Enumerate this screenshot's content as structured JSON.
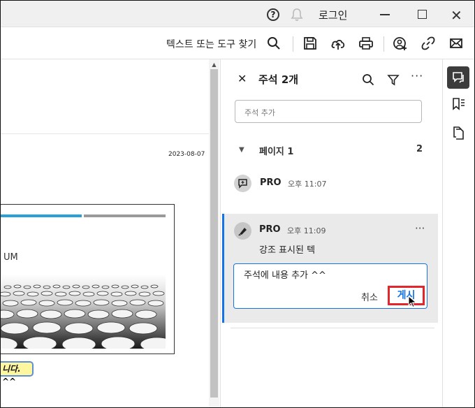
{
  "titlebar": {
    "login_label": "로그인",
    "help_icon": "question-circle-icon",
    "bell_icon": "bell-icon"
  },
  "toolbar": {
    "search_label": "텍스트 또는 도구 찾기",
    "icons": [
      "search-icon",
      "save-icon",
      "cloud-upload-icon",
      "print-icon",
      "share-user-icon",
      "link-icon",
      "mail-icon"
    ]
  },
  "document": {
    "date": "2023-08-07",
    "card_text": "UM",
    "highlight_text": "니다. ^^"
  },
  "panel": {
    "title": "주석 2개",
    "add_placeholder": "주석 추가",
    "page_group_label": "페이지 1",
    "page_group_count": "2",
    "comments": [
      {
        "user": "PRO",
        "time": "오후 11:07",
        "icon": "sticky-note-icon"
      },
      {
        "user": "PRO",
        "time": "오후 11:09",
        "icon": "highlighter-icon",
        "text": "강조 표시된 텍",
        "reply_text": "주석에 내용 추가 ^^",
        "cancel_label": "취소",
        "post_label": "게시"
      }
    ]
  },
  "colors": {
    "accent": "#1473e6",
    "highlight_frame": "#e3262c",
    "selected_background": "#eaeaea"
  }
}
